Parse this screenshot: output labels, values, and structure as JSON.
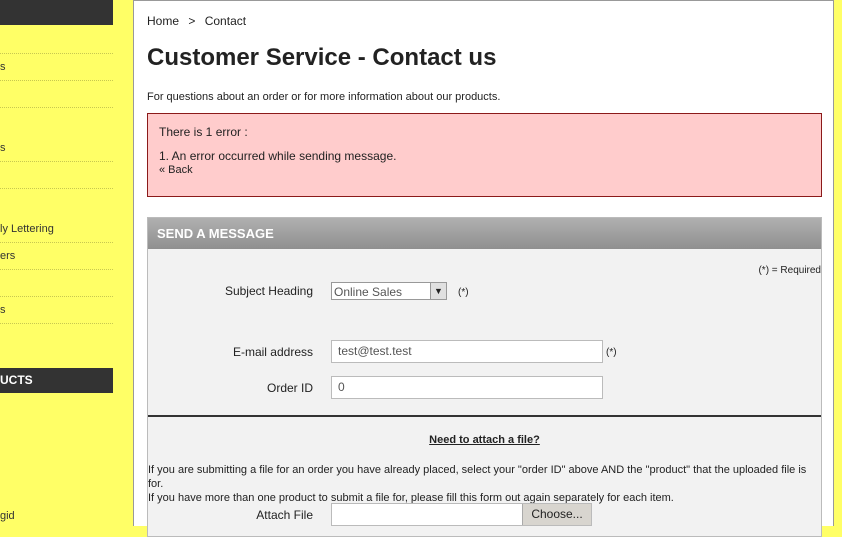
{
  "sidebar": {
    "top_header": "",
    "items": [
      "",
      "s",
      "",
      "s",
      "",
      "ly Lettering",
      "ers",
      "",
      "s"
    ],
    "products_header": "UCTS",
    "bottom_item": "gid"
  },
  "breadcrumb": {
    "home": "Home",
    "separator": ">",
    "current": "Contact"
  },
  "page_title": "Customer Service - Contact us",
  "intro": "For questions about an order or for more information about our products.",
  "error": {
    "title": "There is 1 error :",
    "message": "1.  An error occurred while sending message.",
    "back": "« Back"
  },
  "form": {
    "heading": "SEND A MESSAGE",
    "required_note": "(*) = Required",
    "subject_label": "Subject Heading",
    "subject_value": "Online Sales",
    "subject_arrow": "▼",
    "required_star": "(*)",
    "email_label": "E-mail address",
    "email_value": "test@test.test",
    "order_label": "Order ID",
    "order_value": "0",
    "attach_title": "Need to attach a file?",
    "attach_text_1": "If you are submitting a file for an order you have already placed, select your \"order ID\" above AND the \"product\" that the uploaded file is for.",
    "attach_text_2": "If you have more than one product to submit a file for, please fill this form out again separately for each item.",
    "attach_label": "Attach File",
    "choose_label": "Choose..."
  },
  "colors": {
    "sidebar_bg": "#ffff66",
    "dark_header": "#333333",
    "error_bg": "#ffcccc",
    "error_border": "#8b1a1a"
  }
}
